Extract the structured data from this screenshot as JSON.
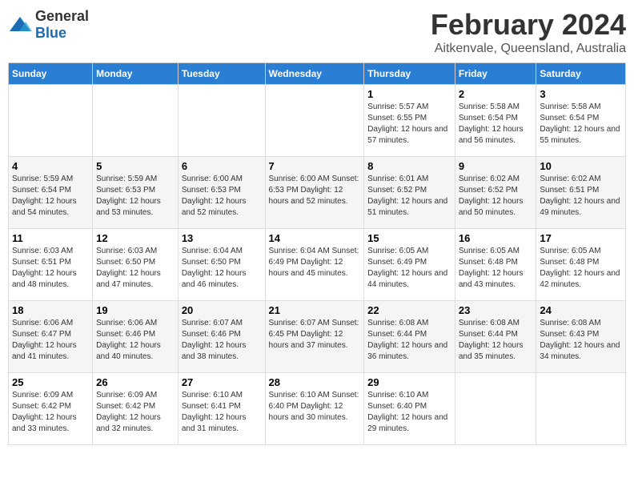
{
  "header": {
    "logo_general": "General",
    "logo_blue": "Blue",
    "title": "February 2024",
    "subtitle": "Aitkenvale, Queensland, Australia"
  },
  "columns": [
    "Sunday",
    "Monday",
    "Tuesday",
    "Wednesday",
    "Thursday",
    "Friday",
    "Saturday"
  ],
  "weeks": [
    [
      {
        "day": "",
        "info": ""
      },
      {
        "day": "",
        "info": ""
      },
      {
        "day": "",
        "info": ""
      },
      {
        "day": "",
        "info": ""
      },
      {
        "day": "1",
        "info": "Sunrise: 5:57 AM\nSunset: 6:55 PM\nDaylight: 12 hours\nand 57 minutes."
      },
      {
        "day": "2",
        "info": "Sunrise: 5:58 AM\nSunset: 6:54 PM\nDaylight: 12 hours\nand 56 minutes."
      },
      {
        "day": "3",
        "info": "Sunrise: 5:58 AM\nSunset: 6:54 PM\nDaylight: 12 hours\nand 55 minutes."
      }
    ],
    [
      {
        "day": "4",
        "info": "Sunrise: 5:59 AM\nSunset: 6:54 PM\nDaylight: 12 hours\nand 54 minutes."
      },
      {
        "day": "5",
        "info": "Sunrise: 5:59 AM\nSunset: 6:53 PM\nDaylight: 12 hours\nand 53 minutes."
      },
      {
        "day": "6",
        "info": "Sunrise: 6:00 AM\nSunset: 6:53 PM\nDaylight: 12 hours\nand 52 minutes."
      },
      {
        "day": "7",
        "info": "Sunrise: 6:00 AM\nSunset: 6:53 PM\nDaylight: 12 hours\nand 52 minutes."
      },
      {
        "day": "8",
        "info": "Sunrise: 6:01 AM\nSunset: 6:52 PM\nDaylight: 12 hours\nand 51 minutes."
      },
      {
        "day": "9",
        "info": "Sunrise: 6:02 AM\nSunset: 6:52 PM\nDaylight: 12 hours\nand 50 minutes."
      },
      {
        "day": "10",
        "info": "Sunrise: 6:02 AM\nSunset: 6:51 PM\nDaylight: 12 hours\nand 49 minutes."
      }
    ],
    [
      {
        "day": "11",
        "info": "Sunrise: 6:03 AM\nSunset: 6:51 PM\nDaylight: 12 hours\nand 48 minutes."
      },
      {
        "day": "12",
        "info": "Sunrise: 6:03 AM\nSunset: 6:50 PM\nDaylight: 12 hours\nand 47 minutes."
      },
      {
        "day": "13",
        "info": "Sunrise: 6:04 AM\nSunset: 6:50 PM\nDaylight: 12 hours\nand 46 minutes."
      },
      {
        "day": "14",
        "info": "Sunrise: 6:04 AM\nSunset: 6:49 PM\nDaylight: 12 hours\nand 45 minutes."
      },
      {
        "day": "15",
        "info": "Sunrise: 6:05 AM\nSunset: 6:49 PM\nDaylight: 12 hours\nand 44 minutes."
      },
      {
        "day": "16",
        "info": "Sunrise: 6:05 AM\nSunset: 6:48 PM\nDaylight: 12 hours\nand 43 minutes."
      },
      {
        "day": "17",
        "info": "Sunrise: 6:05 AM\nSunset: 6:48 PM\nDaylight: 12 hours\nand 42 minutes."
      }
    ],
    [
      {
        "day": "18",
        "info": "Sunrise: 6:06 AM\nSunset: 6:47 PM\nDaylight: 12 hours\nand 41 minutes."
      },
      {
        "day": "19",
        "info": "Sunrise: 6:06 AM\nSunset: 6:46 PM\nDaylight: 12 hours\nand 40 minutes."
      },
      {
        "day": "20",
        "info": "Sunrise: 6:07 AM\nSunset: 6:46 PM\nDaylight: 12 hours\nand 38 minutes."
      },
      {
        "day": "21",
        "info": "Sunrise: 6:07 AM\nSunset: 6:45 PM\nDaylight: 12 hours\nand 37 minutes."
      },
      {
        "day": "22",
        "info": "Sunrise: 6:08 AM\nSunset: 6:44 PM\nDaylight: 12 hours\nand 36 minutes."
      },
      {
        "day": "23",
        "info": "Sunrise: 6:08 AM\nSunset: 6:44 PM\nDaylight: 12 hours\nand 35 minutes."
      },
      {
        "day": "24",
        "info": "Sunrise: 6:08 AM\nSunset: 6:43 PM\nDaylight: 12 hours\nand 34 minutes."
      }
    ],
    [
      {
        "day": "25",
        "info": "Sunrise: 6:09 AM\nSunset: 6:42 PM\nDaylight: 12 hours\nand 33 minutes."
      },
      {
        "day": "26",
        "info": "Sunrise: 6:09 AM\nSunset: 6:42 PM\nDaylight: 12 hours\nand 32 minutes."
      },
      {
        "day": "27",
        "info": "Sunrise: 6:10 AM\nSunset: 6:41 PM\nDaylight: 12 hours\nand 31 minutes."
      },
      {
        "day": "28",
        "info": "Sunrise: 6:10 AM\nSunset: 6:40 PM\nDaylight: 12 hours\nand 30 minutes."
      },
      {
        "day": "29",
        "info": "Sunrise: 6:10 AM\nSunset: 6:40 PM\nDaylight: 12 hours\nand 29 minutes."
      },
      {
        "day": "",
        "info": ""
      },
      {
        "day": "",
        "info": ""
      }
    ]
  ]
}
